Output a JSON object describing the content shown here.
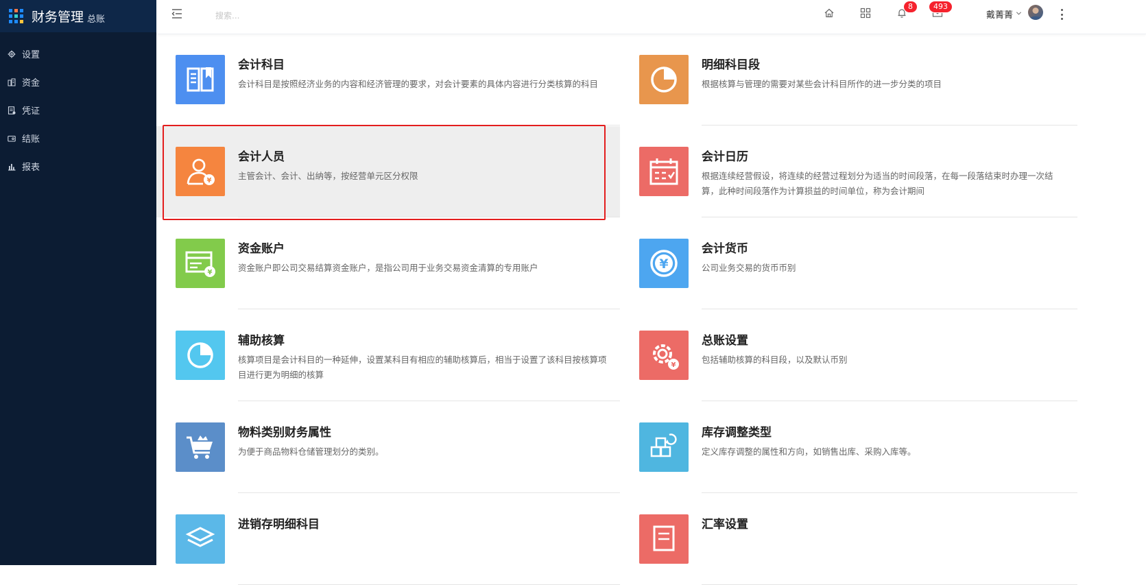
{
  "app": {
    "title": "财务管理",
    "subtitle": "总账"
  },
  "sidebar": {
    "items": [
      {
        "label": "设置",
        "icon": "gear-icon"
      },
      {
        "label": "资金",
        "icon": "ledger-icon"
      },
      {
        "label": "凭证",
        "icon": "voucher-icon"
      },
      {
        "label": "结账",
        "icon": "wallet-icon"
      },
      {
        "label": "报表",
        "icon": "bar-chart-icon"
      }
    ]
  },
  "topbar": {
    "search_placeholder": "搜索...",
    "notifications_count": "8",
    "messages_count": "493",
    "user_name": "戴菁菁"
  },
  "cards": [
    {
      "title": "会计科目",
      "desc": "会计科目是按照经济业务的内容和经济管理的要求，对会计要素的具体内容进行分类核算的科目",
      "color": "#4d8ff0",
      "icon": "book-icon"
    },
    {
      "title": "明细科目段",
      "desc": "根据核算与管理的需要对某些会计科目所作的进一步分类的项目",
      "color": "#e8964d",
      "icon": "pie-chart-icon"
    },
    {
      "title": "会计人员",
      "desc": "主管会计、会计、出纳等，按经营单元区分权限",
      "color": "#f5853f",
      "icon": "accountant-icon"
    },
    {
      "title": "会计日历",
      "desc": "根据连续经营假设，将连续的经营过程划分为适当的时间段落，在每一段落结束时办理一次结算，此种时间段落作为计算损益的时间单位，称为会计期间",
      "color": "#ec6b66",
      "icon": "calendar-icon"
    },
    {
      "title": "资金账户",
      "desc": "资金账户即公司交易结算资金账户，是指公司用于业务交易资金清算的专用账户",
      "color": "#82cb4b",
      "icon": "card-yen-icon"
    },
    {
      "title": "会计货币",
      "desc": "公司业务交易的货币币别",
      "color": "#4da6f0",
      "icon": "yen-coin-icon"
    },
    {
      "title": "辅助核算",
      "desc": "核算项目是会计科目的一种延伸，设置某科目有相应的辅助核算后，相当于设置了该科目按核算项目进行更为明细的核算",
      "color": "#53c7ef",
      "icon": "pie-chart-icon"
    },
    {
      "title": "总账设置",
      "desc": "包括辅助核算的科目段，以及默认币别",
      "color": "#ec6b66",
      "icon": "gear-yen-icon"
    },
    {
      "title": "物料类别财务属性",
      "desc": "为便于商品物料仓储管理划分的类别。",
      "color": "#5b8ec9",
      "icon": "cart-icon"
    },
    {
      "title": "库存调整类型",
      "desc": "定义库存调整的属性和方向，如销售出库、采购入库等。",
      "color": "#4fb6e0",
      "icon": "boxes-icon"
    },
    {
      "title": "进销存明细科目",
      "desc": "",
      "color": "#5bb8e8",
      "icon": "stack-icon"
    },
    {
      "title": "汇率设置",
      "desc": "",
      "color": "#ec6b66",
      "icon": "exchange-icon"
    }
  ]
}
